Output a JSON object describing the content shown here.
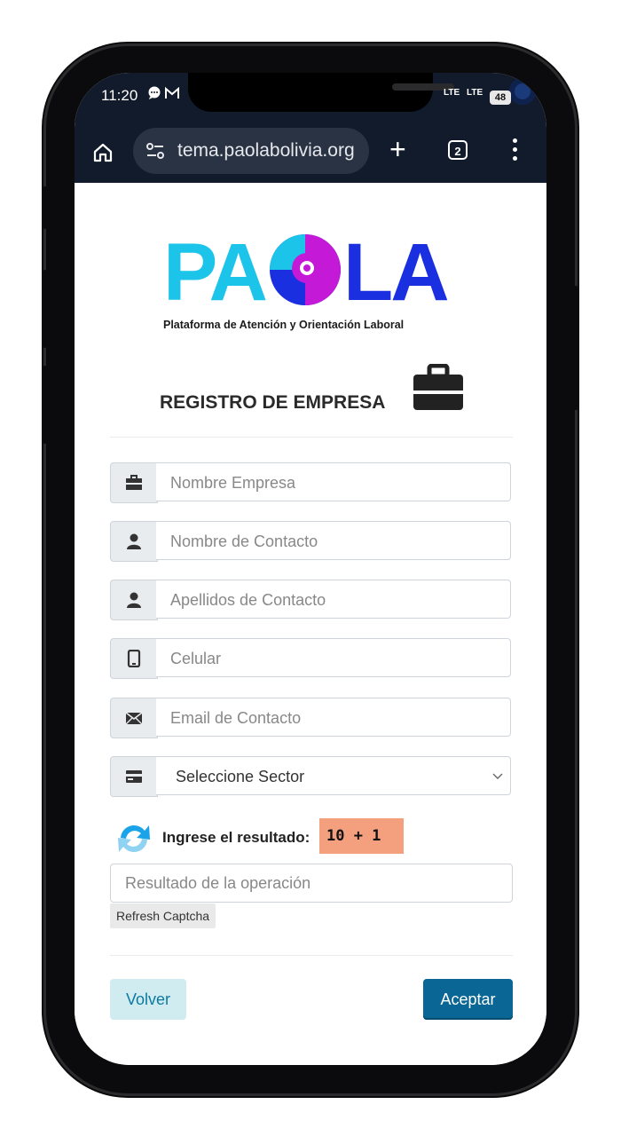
{
  "status_bar": {
    "time": "11:20",
    "battery": "48",
    "signal_1": "LTE",
    "signal_2": "LTE"
  },
  "browser": {
    "url": "tema.paolabolivia.org",
    "tab_count": "2"
  },
  "logo": {
    "wordmark": "PAOLA",
    "tagline": "Plataforma de Atención y Orientación Laboral",
    "colors": {
      "cyan": "#1cc4ea",
      "blue": "#1a2fe0",
      "magenta": "#c41ad8"
    }
  },
  "form": {
    "title": "REGISTRO DE EMPRESA",
    "fields": [
      {
        "placeholder": "Nombre Empresa",
        "icon": "briefcase-icon"
      },
      {
        "placeholder": "Nombre de Contacto",
        "icon": "user-icon"
      },
      {
        "placeholder": "Apellidos de Contacto",
        "icon": "user-icon"
      },
      {
        "placeholder": "Celular",
        "icon": "mobile-icon"
      },
      {
        "placeholder": "Email de Contacto",
        "icon": "envelope-icon"
      }
    ],
    "sector": {
      "selected": "Seleccione Sector",
      "icon": "credit-card-icon"
    },
    "captcha": {
      "label": "Ingrese el resultado:",
      "expression": "10 + 1",
      "input_placeholder": "Resultado de la operación",
      "refresh_label": "Refresh Captcha",
      "color": "#f4a07e"
    },
    "buttons": {
      "back": "Volver",
      "submit": "Aceptar"
    }
  }
}
